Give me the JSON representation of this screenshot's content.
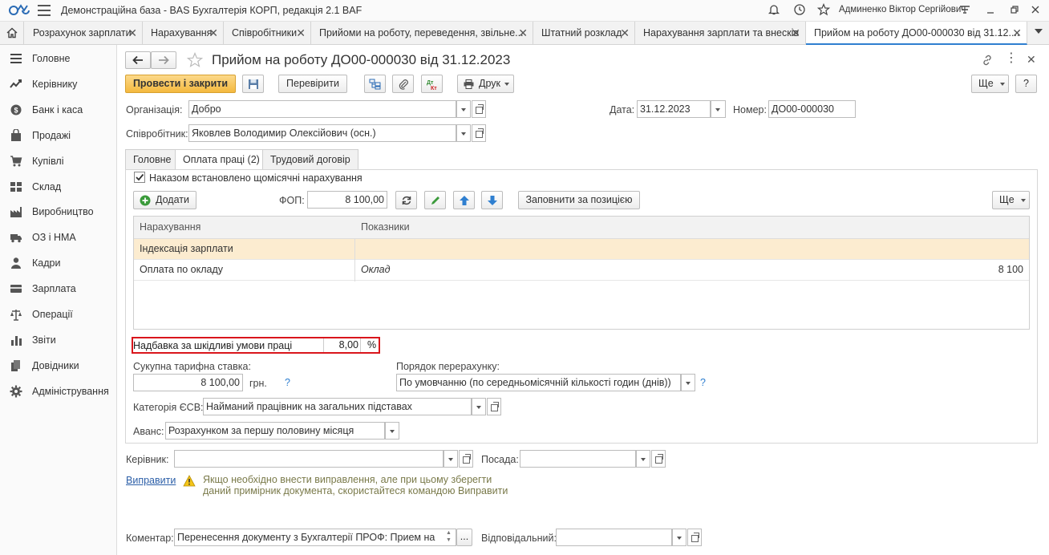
{
  "window": {
    "title": "Демонстраційна база - BAS Бухгалтерія КОРП, редакція 2.1 BAF",
    "user": "Админенко Віктор Сергійович"
  },
  "open_tabs": [
    {
      "label": "Розрахунок зарплати"
    },
    {
      "label": "Нарахування"
    },
    {
      "label": "Співробітники"
    },
    {
      "label": "Прийоми на роботу, переведення, звільне..."
    },
    {
      "label": "Штатний розклад"
    },
    {
      "label": "Нарахування зарплати та внесків"
    },
    {
      "label": "Прийом на роботу ДО00-000030 від 31.12...."
    }
  ],
  "sidebar": {
    "items": [
      {
        "label": "Головне",
        "icon": "menu-icon"
      },
      {
        "label": "Керівнику",
        "icon": "chart-line-icon"
      },
      {
        "label": "Банк і каса",
        "icon": "coins-icon"
      },
      {
        "label": "Продажі",
        "icon": "bag-icon"
      },
      {
        "label": "Купівлі",
        "icon": "cart-icon"
      },
      {
        "label": "Склад",
        "icon": "warehouse-icon"
      },
      {
        "label": "Виробництво",
        "icon": "factory-icon"
      },
      {
        "label": "ОЗ і НМА",
        "icon": "truck-icon"
      },
      {
        "label": "Кадри",
        "icon": "person-icon"
      },
      {
        "label": "Зарплата",
        "icon": "wallet-icon"
      },
      {
        "label": "Операції",
        "icon": "scales-icon"
      },
      {
        "label": "Звіти",
        "icon": "bar-chart-icon"
      },
      {
        "label": "Довідники",
        "icon": "books-icon"
      },
      {
        "label": "Адміністрування",
        "icon": "gear-icon"
      }
    ]
  },
  "document": {
    "title": "Прийом на роботу ДО00-000030 від 31.12.2023",
    "toolbar": {
      "post_close": "Провести і закрити",
      "check": "Перевірити",
      "print": "Друк",
      "more": "Ще",
      "help": "?"
    },
    "organization": {
      "label": "Організація:",
      "value": "Добро"
    },
    "date": {
      "label": "Дата:",
      "value": "31.12.2023"
    },
    "number": {
      "label": "Номер:",
      "value": "ДО00-000030"
    },
    "employee": {
      "label": "Співробітник:",
      "value": "Яковлев Володимир Олексійович (осн.)"
    },
    "tabs": [
      {
        "label": "Головне"
      },
      {
        "label": "Оплата праці (2)"
      },
      {
        "label": "Трудовий договір"
      }
    ],
    "pay": {
      "monthly_checkbox": "Наказом встановлено щомісячні нарахування",
      "add_button": "Додати",
      "fop_label": "ФОП:",
      "fop_value": "8 100,00",
      "fill_button": "Заповнити за позицією",
      "more": "Ще",
      "grid_headers": [
        "Нарахування",
        "Показники"
      ],
      "rows": [
        {
          "accrual": "Індексація зарплати",
          "indicator": "",
          "value": ""
        },
        {
          "accrual": "Оплата по окладу",
          "indicator": "Оклад",
          "value": "8 100"
        }
      ],
      "hazard": {
        "label": "Надбавка за шкідливі умови праці",
        "value": "8,00",
        "unit": "%"
      },
      "tariff": {
        "label": "Сукупна тарифна ставка:",
        "value": "8 100,00",
        "unit": "грн.",
        "help": "?"
      },
      "recalc": {
        "label": "Порядок перерахунку:",
        "value": "По умовчанню (по середньомісячній кількості годин (днів))",
        "help": "?"
      },
      "esv": {
        "label": "Категорія ЄСВ:",
        "value": "Найманий працівник на загальних підставах"
      },
      "advance": {
        "label": "Аванс:",
        "value": "Розрахунком за першу половину місяця"
      }
    },
    "head": {
      "label": "Керівник:",
      "value": ""
    },
    "position": {
      "label": "Посада:",
      "value": ""
    },
    "correct": {
      "link": "Виправити",
      "hint_line1": "Якщо необхідно внести виправлення, але при цьому зберегти",
      "hint_line2": "даний примірник документа, скористайтеся командою Виправити"
    },
    "comment": {
      "label": "Коментар:",
      "value": "Перенесення документу з Бухгалтерії ПРОФ: Прием на",
      "more": "..."
    },
    "responsible": {
      "label": "Відповідальний:",
      "value": ""
    }
  },
  "colors": {
    "accent": "#2f7fd0",
    "primary_button": "#f4b93e",
    "selected_row": "#fcecd0",
    "highlight_border": "#d9161c"
  }
}
